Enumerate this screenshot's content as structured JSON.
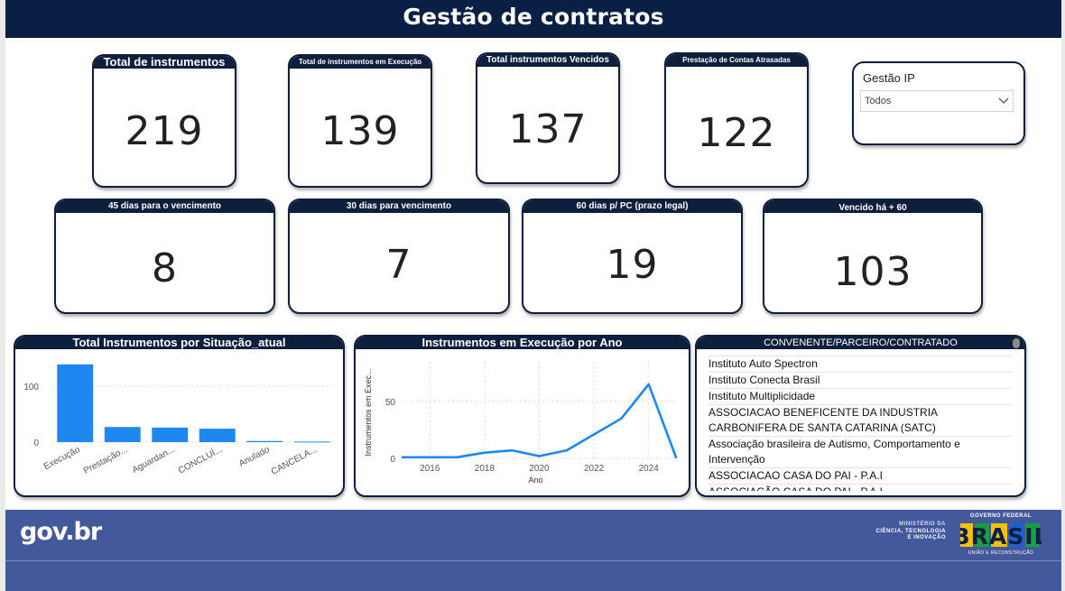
{
  "header": {
    "title": "Gestão de contratos"
  },
  "kpis": [
    {
      "label": "Total de instrumentos",
      "value": "219"
    },
    {
      "label": "Total de instrumentos em Execução",
      "value": "139"
    },
    {
      "label": "Total instrumentos Vencidos",
      "value": "137"
    },
    {
      "label": "Prestação de Contas Atrasadas",
      "value": "122"
    },
    {
      "label": "45 dias para o vencimento",
      "value": "8"
    },
    {
      "label": "30 dias para vencimento",
      "value": "7"
    },
    {
      "label": "60 dias p/ PC (prazo legal)",
      "value": "19"
    },
    {
      "label": "Vencido há + 60",
      "value": "103"
    }
  ],
  "slicer": {
    "label": "Gestão IP",
    "value": "Todos",
    "icon": "chevron-down-icon"
  },
  "bar_panel": {
    "title": "Total Instrumentos por Situação_atual"
  },
  "line_panel": {
    "title": "Instrumentos em Execução por Ano"
  },
  "table": {
    "header": "CONVENENTE/PARCEIRO/CONTRATADO",
    "rows": [
      "Instituto Auto Spectron",
      "Instituto Conecta Brasil",
      "Instituto Multiplicidade",
      "ASSOCIACAO BENEFICENTE DA INDUSTRIA CARBONIFERA DE SANTA CATARINA (SATC)",
      "Associação brasileira de Autismo, Comportamento e Intervenção",
      "ASSOCIACAO CASA DO PAI - P.A.I",
      "ASSOCIAÇÃO CASA DO PAI - P.A.I"
    ]
  },
  "footer": {
    "logo_text": "gov.br",
    "ministry_lines": [
      "MINISTÉRIO DA",
      "CIÊNCIA, TECNOLOGIA",
      "E INOVAÇÃO"
    ],
    "gov_top": "GOVERNO FEDERAL",
    "gov_word": "BRASIL",
    "gov_bottom": "UNIÃO E RECONSTRUÇÃO"
  },
  "colors": {
    "navy": "#0d1f3c",
    "bar": "#1e88f0",
    "footer": "#44589c"
  },
  "chart_data": [
    {
      "type": "bar",
      "title": "Total Instrumentos por Situação_atual",
      "categories": [
        "Execução",
        "Prestação...",
        "Aguardan...",
        "CONCLUÍ...",
        "Anulado",
        "CANCELA..."
      ],
      "values": [
        139,
        27,
        26,
        24,
        2,
        1
      ],
      "yticks": [
        0,
        100
      ],
      "ylim": [
        0,
        150
      ],
      "grid": true
    },
    {
      "type": "line",
      "title": "Instrumentos em Execução por Ano",
      "xlabel": "Ano",
      "ylabel": "Instrumentos em Exec...",
      "x": [
        2015,
        2016,
        2017,
        2018,
        2019,
        2020,
        2021,
        2022,
        2023,
        2024,
        2025
      ],
      "values": [
        1,
        1,
        1,
        5,
        7,
        2,
        7,
        21,
        35,
        65,
        1
      ],
      "xticks": [
        2016,
        2018,
        2020,
        2022,
        2024
      ],
      "yticks": [
        0,
        50
      ],
      "ylim": [
        0,
        80
      ],
      "grid": true
    }
  ]
}
